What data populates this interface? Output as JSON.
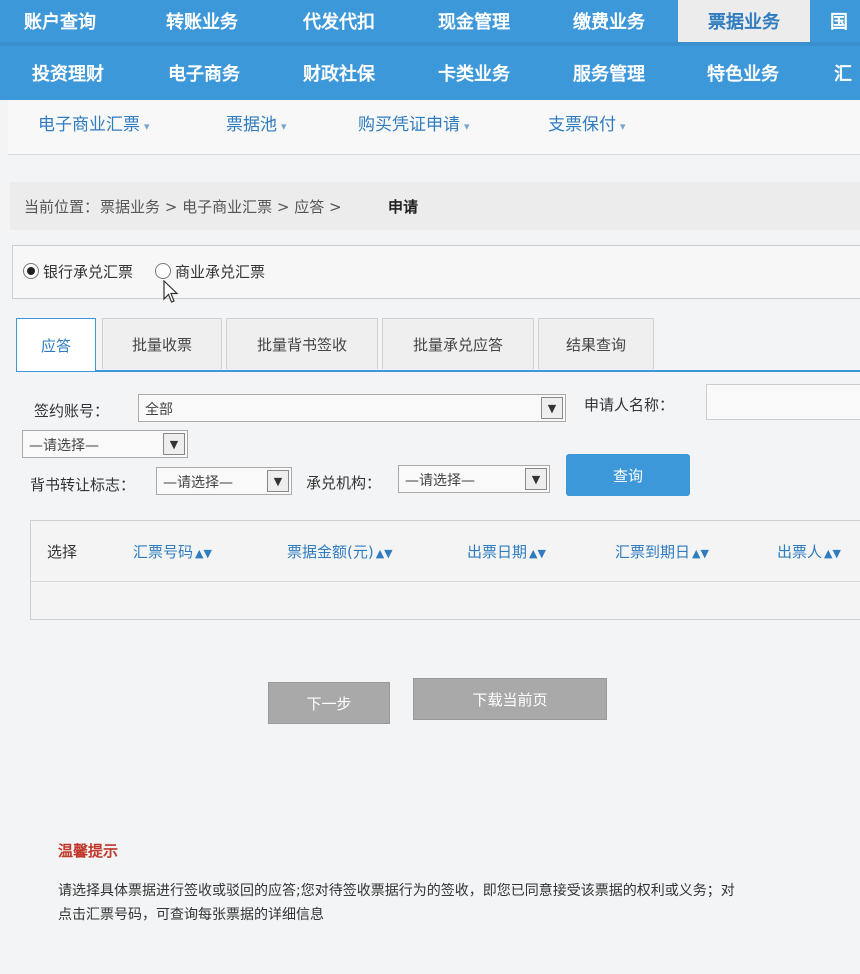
{
  "top_nav": {
    "row1": [
      "账户查询",
      "转账业务",
      "代发代扣",
      "现金管理",
      "缴费业务",
      "票据业务",
      "国"
    ],
    "row2": [
      "投资理财",
      "电子商务",
      "财政社保",
      "卡类业务",
      "服务管理",
      "特色业务",
      "汇"
    ],
    "active": "票据业务"
  },
  "sub_nav": [
    "电子商业汇票",
    "票据池",
    "购买凭证申请",
    "支票保付"
  ],
  "breadcrumb": {
    "prefix": "当前位置：",
    "path": "票据业务 > 电子商业汇票 > 应答 >",
    "current": "申请"
  },
  "bill_type": {
    "options": [
      "银行承兑汇票",
      "商业承兑汇票"
    ],
    "selected": "银行承兑汇票"
  },
  "tabs": [
    "应答",
    "批量收票",
    "批量背书签收",
    "批量承兑应答",
    "结果查询"
  ],
  "active_tab": "应答",
  "form": {
    "account_label": "签约账号：",
    "account_value": "全部",
    "applicant_label": "申请人名称：",
    "applicant_value": "",
    "type_select_value": "—请选择—",
    "endorse_label": "背书转让标志：",
    "endorse_value": "—请选择—",
    "acceptor_label": "承兑机构：",
    "acceptor_value": "—请选择—",
    "query_button": "查询"
  },
  "table": {
    "columns": [
      "选择",
      "汇票号码",
      "票据金额(元)",
      "出票日期",
      "汇票到期日",
      "出票人"
    ]
  },
  "buttons": {
    "next": "下一步",
    "download": "下载当前页"
  },
  "tips": {
    "title": "温馨提示",
    "line1": "请选择具体票据进行签收或驳回的应答;您对待签收票据行为的签收，即您已同意接受该票据的权利或义务；对",
    "line2": "点击汇票号码，可查询每张票据的详细信息"
  },
  "colors": {
    "nav_blue": "#3d98da",
    "tip_red": "#c0392b"
  }
}
